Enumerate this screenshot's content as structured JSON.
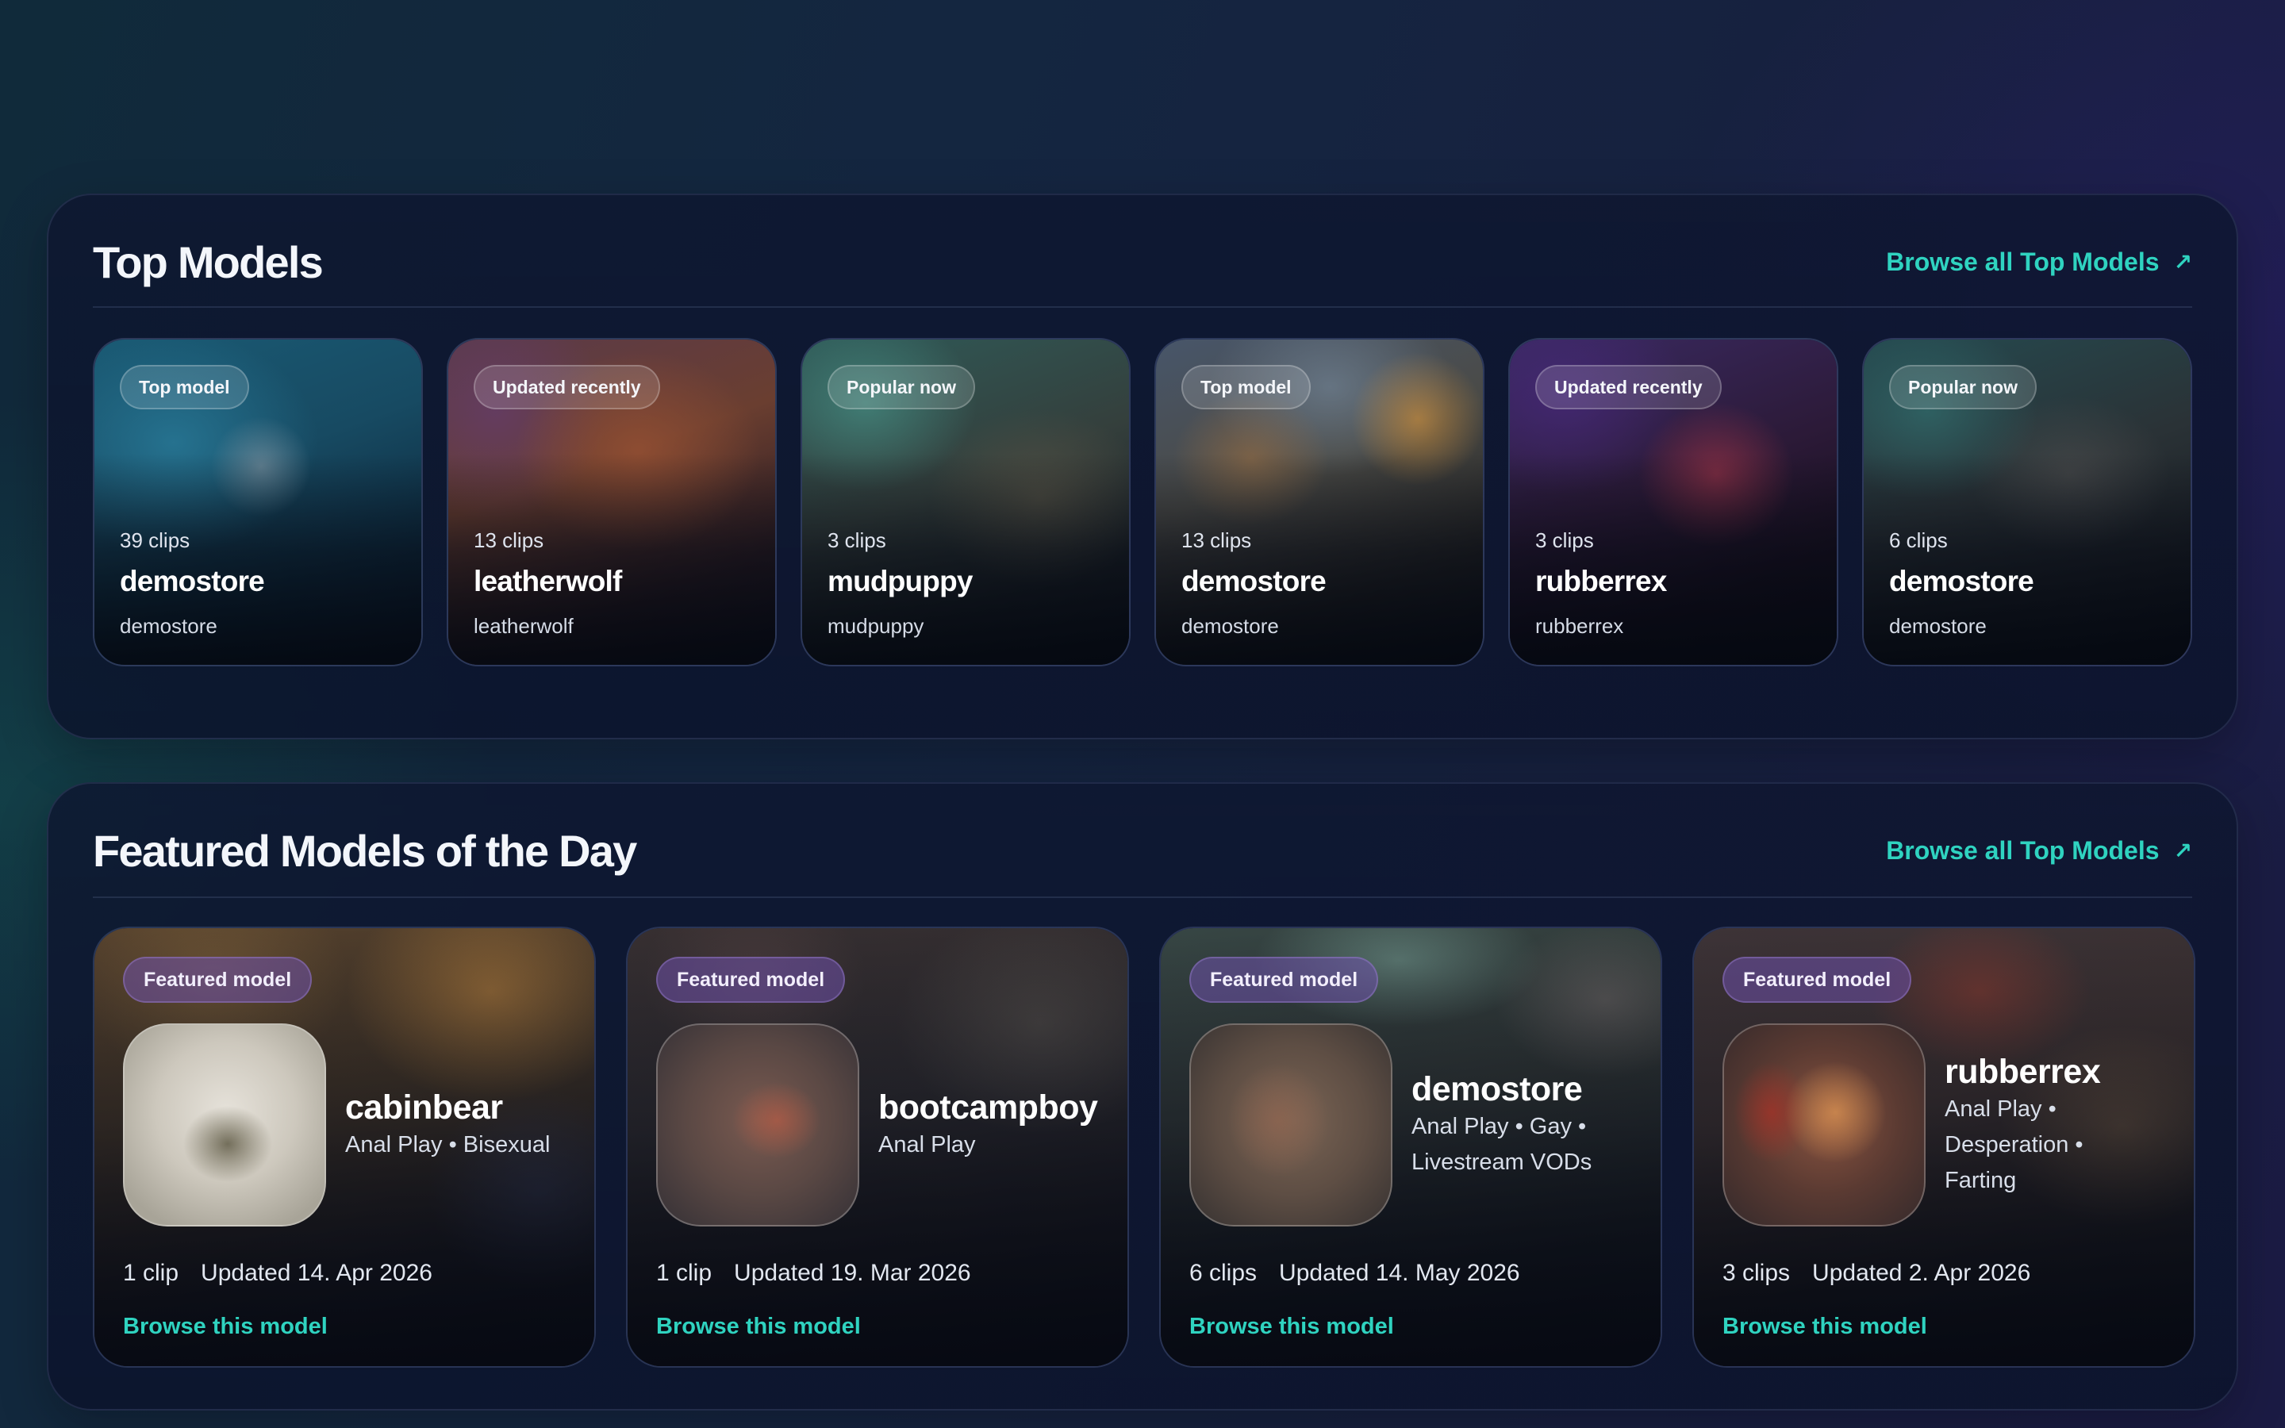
{
  "sections": {
    "top": {
      "title": "Top Models",
      "browse_all": "Browse all Top Models",
      "cards": [
        {
          "tag": "Top model",
          "clips": "39 clips",
          "name": "demostore",
          "handle": "demostore"
        },
        {
          "tag": "Updated recently",
          "clips": "13 clips",
          "name": "leatherwolf",
          "handle": "leatherwolf"
        },
        {
          "tag": "Popular now",
          "clips": "3 clips",
          "name": "mudpuppy",
          "handle": "mudpuppy"
        },
        {
          "tag": "Top model",
          "clips": "13 clips",
          "name": "demostore",
          "handle": "demostore"
        },
        {
          "tag": "Updated recently",
          "clips": "3 clips",
          "name": "rubberrex",
          "handle": "rubberrex"
        },
        {
          "tag": "Popular now",
          "clips": "6 clips",
          "name": "demostore",
          "handle": "demostore"
        }
      ]
    },
    "featured": {
      "title": "Featured Models of the Day",
      "browse_all": "Browse all Top Models",
      "cards": [
        {
          "tag": "Featured model",
          "name": "cabinbear",
          "categories": "Anal Play • Bisexual",
          "clips": "1 clip",
          "updated": "Updated 14. Apr 2026",
          "browse": "Browse this model"
        },
        {
          "tag": "Featured model",
          "name": "bootcampboy",
          "categories": "Anal Play",
          "clips": "1 clip",
          "updated": "Updated 19. Mar 2026",
          "browse": "Browse this model"
        },
        {
          "tag": "Featured model",
          "name": "demostore",
          "categories": "Anal Play • Gay • Livestream VODs",
          "clips": "6 clips",
          "updated": "Updated 14. May 2026",
          "browse": "Browse this model"
        },
        {
          "tag": "Featured model",
          "name": "rubberrex",
          "categories": "Anal Play • Desperation • Farting",
          "clips": "3 clips",
          "updated": "Updated 2. Apr 2026",
          "browse": "Browse this model"
        }
      ]
    }
  },
  "icons": {
    "browse_all_arrow": "arrow-up-right-icon"
  },
  "colors": {
    "accent": "#2fd3c0",
    "featured_tag": "#6e50aa",
    "background": "#142640"
  }
}
